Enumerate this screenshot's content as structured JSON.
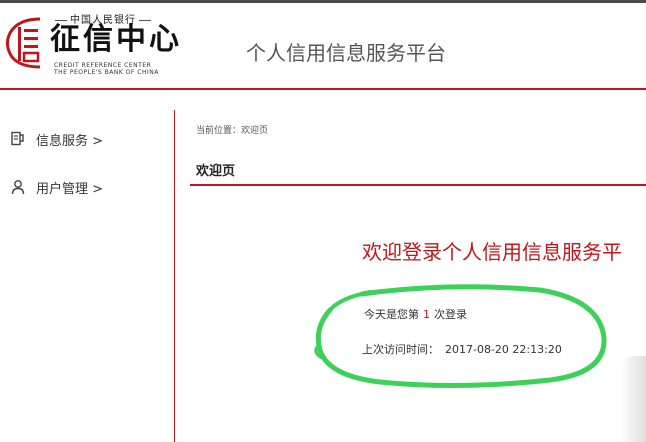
{
  "header": {
    "logo_top_text": "中国人民银行",
    "logo_main_text": "征信中心",
    "logo_en_line1": "CREDIT REFERENCE CENTER",
    "logo_en_line2": "THE PEOPLE'S BANK OF CHINA",
    "platform_title": "个人信用信息服务平台"
  },
  "sidebar": {
    "items": [
      {
        "label": "信息服务 >",
        "icon": "document-icon"
      },
      {
        "label": "用户管理 >",
        "icon": "user-icon"
      }
    ]
  },
  "main": {
    "breadcrumb": "当前位置：欢迎页",
    "page_title": "欢迎页",
    "welcome_heading": "欢迎登录个人信用信息服务平",
    "login_prefix": "今天是您第",
    "login_count": "1",
    "login_suffix": "次登录",
    "last_visit_label": "上次访问时间：",
    "last_visit_time": "2017-08-20 22:13:20"
  },
  "colors": {
    "brand_red": "#c0161b",
    "annotation_green": "#3dd15a"
  }
}
